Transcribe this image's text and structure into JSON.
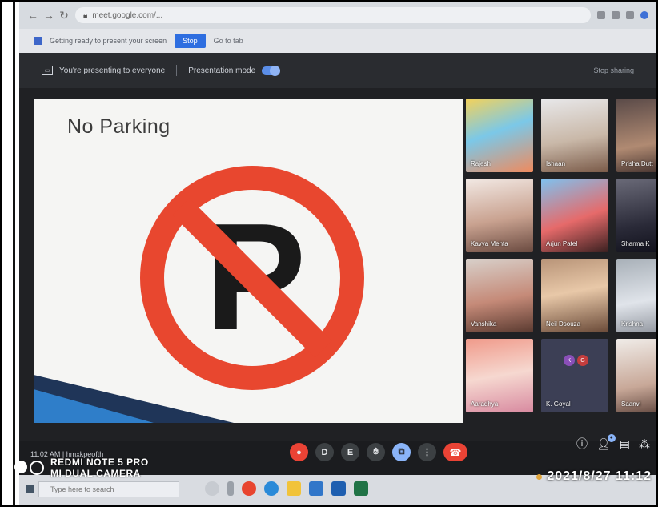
{
  "browser": {
    "address": "meet.google.com/..."
  },
  "info_bar": {
    "text": "Getting ready to present your screen",
    "button": "Stop",
    "link": "Go to tab"
  },
  "present_bar": {
    "text": "You're presenting to everyone",
    "mode_label": "Presentation mode",
    "right_text": "Stop sharing"
  },
  "slide": {
    "title": "No Parking",
    "sign_letter": "P",
    "colors": {
      "ring": "#e8472f",
      "letter": "#1a1a1a",
      "wedge_dark": "#1f3558",
      "wedge_light": "#2f7ec9"
    }
  },
  "participants": [
    {
      "name": "Rajesh"
    },
    {
      "name": "Ishaan"
    },
    {
      "name": "Prisha Dutt"
    },
    {
      "name": "Kavya Mehta"
    },
    {
      "name": "Arjun Patel"
    },
    {
      "name": "Sharma K"
    },
    {
      "name": "Vanshika"
    },
    {
      "name": "Neil Dsouza"
    },
    {
      "name": "Krishna"
    },
    {
      "name": "Aaradhya"
    },
    {
      "name": "K. Goyal",
      "initials": [
        "K",
        "G"
      ]
    },
    {
      "name": "Saanvi"
    }
  ],
  "controls": {
    "clock": "11:02 AM | hmxkpeofth",
    "buttons": [
      "mic",
      "cc",
      "present-screen",
      "raise-hand",
      "present",
      "more"
    ],
    "end_icon": "end-call-icon"
  },
  "watermark": {
    "line1": "REDMI NOTE 5 PRO",
    "line2": "MI DUAL CAMERA"
  },
  "taskbar": {
    "search_placeholder": "Type here to search",
    "datetime": "2021/8/27  11:12"
  }
}
